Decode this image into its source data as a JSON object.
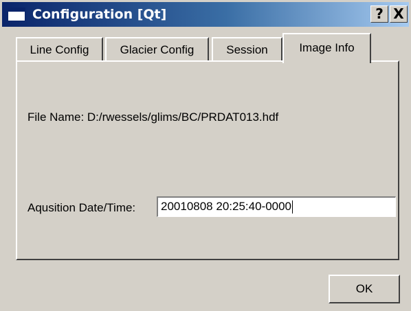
{
  "window": {
    "title": "Configuration [Qt]",
    "help_label": "?",
    "close_label": "X"
  },
  "tabs": [
    {
      "label": "Line Config"
    },
    {
      "label": "Glacier Config"
    },
    {
      "label": "Session"
    },
    {
      "label": "Image Info",
      "active": true
    }
  ],
  "image_info": {
    "file_name_text": "File Name: D:/rwessels/glims/BC/PRDAT013.hdf",
    "date_label": "Aqusition Date/Time:",
    "date_value": "20010808 20:25:40-0000"
  },
  "buttons": {
    "ok_label": "OK"
  }
}
